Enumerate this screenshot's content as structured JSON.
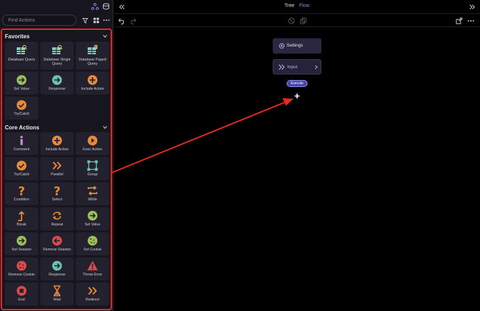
{
  "search": {
    "placeholder": "Find Actions"
  },
  "favorites": {
    "title": "Favorites",
    "items": [
      {
        "label": "Database Query",
        "icon": "database-search-icon",
        "color": "#7fd1c0"
      },
      {
        "label": "Database Single Query",
        "icon": "database-search-icon",
        "color": "#7fd1c0"
      },
      {
        "label": "Database Paged Query",
        "icon": "database-page-icon",
        "color": "#7fd1c0"
      },
      {
        "label": "Set Value",
        "icon": "arrow-right-circle-icon",
        "color": "#9bbf5a"
      },
      {
        "label": "Response",
        "icon": "arrow-right-circle-icon",
        "color": "#6ec1b2"
      },
      {
        "label": "Include Action",
        "icon": "plus-circle-icon",
        "color": "#e88a3c"
      },
      {
        "label": "Try/Catch",
        "icon": "check-circle-icon",
        "color": "#e88a3c"
      }
    ]
  },
  "core": {
    "title": "Core Actions",
    "items": [
      {
        "label": "Comment",
        "icon": "info-icon",
        "color": "#c58ad8"
      },
      {
        "label": "Include Action",
        "icon": "plus-circle-icon",
        "color": "#e88a3c"
      },
      {
        "label": "Exec Action",
        "icon": "play-circle-icon",
        "color": "#e88a3c"
      },
      {
        "label": "Try/Catch",
        "icon": "check-circle-icon",
        "color": "#e88a3c"
      },
      {
        "label": "Parallel",
        "icon": "double-chevron-icon",
        "color": "#e88a3c"
      },
      {
        "label": "Group",
        "icon": "group-icon",
        "color": "#6ec1b2"
      },
      {
        "label": "Condition",
        "icon": "question-icon",
        "color": "#e88a3c"
      },
      {
        "label": "Select",
        "icon": "question-icon",
        "color": "#e88a3c"
      },
      {
        "label": "While",
        "icon": "loop-icon",
        "color": "#e88a3c"
      },
      {
        "label": "Break",
        "icon": "break-icon",
        "color": "#e88a3c"
      },
      {
        "label": "Repeat",
        "icon": "repeat-icon",
        "color": "#e88a3c"
      },
      {
        "label": "Set Value",
        "icon": "arrow-right-circle-icon",
        "color": "#9bbf5a"
      },
      {
        "label": "Set Session",
        "icon": "arrow-right-circle-icon",
        "color": "#9bbf5a"
      },
      {
        "label": "Remove Session",
        "icon": "arrow-left-circle-icon",
        "color": "#d94b4b"
      },
      {
        "label": "Set Cookie",
        "icon": "cookie-icon",
        "color": "#9bbf5a"
      },
      {
        "label": "Remove Cookie",
        "icon": "cookie-icon",
        "color": "#d94b4b"
      },
      {
        "label": "Response",
        "icon": "arrow-right-circle-icon",
        "color": "#6ec1b2"
      },
      {
        "label": "Throw Error",
        "icon": "warning-icon",
        "color": "#d94b4b"
      },
      {
        "label": "End",
        "icon": "stop-icon",
        "color": "#d94b4b"
      },
      {
        "label": "Wait",
        "icon": "hourglass-icon",
        "color": "#e88a3c"
      },
      {
        "label": "Redirect",
        "icon": "double-chevron-icon",
        "color": "#e88a3c"
      }
    ]
  },
  "header": {
    "tab_tree": "Tree",
    "tab_flow": "Flow"
  },
  "flow": {
    "settings_label": "Settings",
    "input_label": "Input",
    "execute_label": "Execute"
  },
  "colors": {
    "accent": "#8e8cf8",
    "highlight": "#e8291f"
  }
}
